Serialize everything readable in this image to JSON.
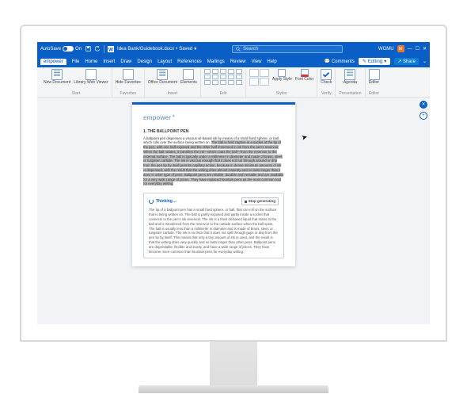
{
  "colors": {
    "brand": "#0a5fc7",
    "accent": "#e77a2e"
  },
  "titlebar": {
    "autosave_label": "AutoSave",
    "autosave_state": "On",
    "doc_title": "Idea Bank/Guidebook.docx",
    "doc_status": "Saved",
    "search_placeholder": "Search",
    "account_name": "WGMU",
    "avatar_initial": "M"
  },
  "menubar": {
    "items": [
      "empower",
      "File",
      "Home",
      "Insert",
      "Draw",
      "Design",
      "Layout",
      "References",
      "Mailings",
      "Review",
      "View",
      "Help"
    ],
    "active_index": 0,
    "comments_label": "Comments",
    "editing_label": "Editing",
    "share_label": "Share"
  },
  "ribbon": {
    "groups": [
      {
        "title": "Start",
        "buttons": [
          {
            "label": "New Document"
          },
          {
            "label": "Library Web Viewer"
          }
        ]
      },
      {
        "title": "Favorites",
        "buttons": [
          {
            "label": "Hide Favorites"
          }
        ]
      },
      {
        "title": "Insert",
        "buttons": [
          {
            "label": "Office Document"
          },
          {
            "label": "Elements"
          }
        ]
      },
      {
        "title": "Edit",
        "buttons": []
      },
      {
        "title": "Styles",
        "buttons": [
          {
            "label": "Apply Style"
          },
          {
            "label": "Font Color"
          }
        ]
      },
      {
        "title": "Verify",
        "buttons": [
          {
            "label": "Check"
          }
        ]
      },
      {
        "title": "Presentation",
        "buttons": [
          {
            "label": "Agenda"
          }
        ]
      },
      {
        "title": "Editor",
        "buttons": [
          {
            "label": "Editor"
          }
        ]
      }
    ]
  },
  "side_rail": {
    "items": [
      "✕",
      "+"
    ]
  },
  "document": {
    "brand": "empower",
    "heading": "1. THE BALLPOINT PEN",
    "para_plain": "A ballpoint pen dispenses a viscous oil-based ink by means of a small hard sphere, or ball, which rolls over the surface being written on. ",
    "para_highlight": "The ball is held captive in a socket at the tip of the pen, with one half exposed and the other half immersed in ink from the pen's reservoir. When the ball rotates, it transfers the ink—which coats the ball—from the reservoir to the external surface. The ball is typically under a millimeter in diameter and made of brass, steel, or tungsten carbide. The ink is viscous enough that it does not run through around or drip from the pen tip by itself permits capillary action, because in dense minimum amounts of ink is dispensed, with the result that the writing dries almost instantly and so lasts longer than it does in other type of pens. Ballpoint pens are reliable, durable and versatile and are available for a very wide range of prices. They have replaced fountain pens as the most common tool for everyday writing."
  },
  "ai": {
    "status": "Thinking…",
    "stop_label": "Stop generating",
    "body": "The tip of a ballpoint pen has a small hard sphere, or ball, that can roll on the surface that is being written on. The ball is partly exposed and partly inside a socket that connects to the pen's ink reservoir. The ink is a thick oil-based liquid that sticks to the ball and is transferred from the reservoir to the outside surface when the ball spins. The ball is usually less than a millimeter in diameter and is made of brass, steel, or tungsten carbide. The ink is so thick that it does not spill through gaps or drip from the pen tip by itself. This means that only a tiny amount of ink is used, and the result is that the writing dries very quickly and so lasts longer than other pens. Ballpoint pens are dependable, flexible and sturdy, and have a wide range of prices. They have become more common than fountain pens for everyday writing."
  }
}
